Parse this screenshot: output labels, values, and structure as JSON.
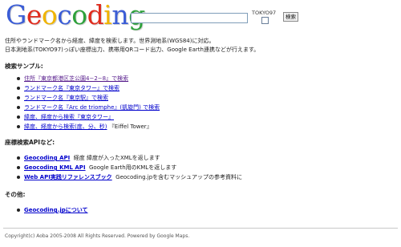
{
  "header": {
    "logo_letters": [
      "G",
      "e",
      "o",
      "c",
      "o",
      "d",
      "i",
      "n",
      "g"
    ],
    "search": {
      "value": "",
      "placeholder": ""
    },
    "tokyo_label": "TOKYO97",
    "tokyo_checked": false,
    "search_button": "検索"
  },
  "description": {
    "line1": "住所やランドマーク名から経度、緯度を検索します。世界測地系(WGS84)に対応。",
    "line2": "日本測地系(TOKYO97)っぽい座標出力、携帯用QRコード出力、Google Earth連携などが行えます。"
  },
  "samples": {
    "heading": "検索サンプル:",
    "items": [
      {
        "link": "住所『東京都港区芝公園4−2−8』で検索",
        "trail": "",
        "visited": true
      },
      {
        "link": "ランドマーク名『東京タワー』で検索",
        "trail": "",
        "visited": false
      },
      {
        "link": "ランドマーク名『東京駅』で検索",
        "trail": "",
        "visited": false
      },
      {
        "link": "ランドマーク名『Arc de triomphe』(凱旋門) で検索",
        "trail": "",
        "visited": false
      },
      {
        "link": "緯度、経度から検索『東京タワー』",
        "trail": "",
        "visited": false
      },
      {
        "link": "緯度、経度から検索(度、分、秒)",
        "trail": "『Eiffel Tower』",
        "visited": false
      }
    ]
  },
  "api": {
    "heading": "座標検索APIなど:",
    "items": [
      {
        "link": "Geocoding API",
        "trail": "経度 緯度が入ったXMLを返します"
      },
      {
        "link": "Geocoding KML API",
        "trail": "Google Earth用のKMLを返します"
      },
      {
        "link": "Web API実践リファレンスブック",
        "trail": "Geocoding.jpを含むマッシュアップの参考資料に"
      }
    ]
  },
  "other": {
    "heading": "その他:",
    "items": [
      {
        "link": "Geocoding.jpについて",
        "trail": ""
      }
    ]
  },
  "footer": {
    "text": "Copyright(c) Aoba 2005-2008 All Rights Reserved. Powered by Google Maps."
  },
  "colors": {
    "link": "#0000cc",
    "visited_link": "#551a8b",
    "logo_blue": "#3b5dd6",
    "logo_red": "#e02c1e",
    "logo_yellow": "#f0b400",
    "logo_green": "#2ea13b"
  }
}
